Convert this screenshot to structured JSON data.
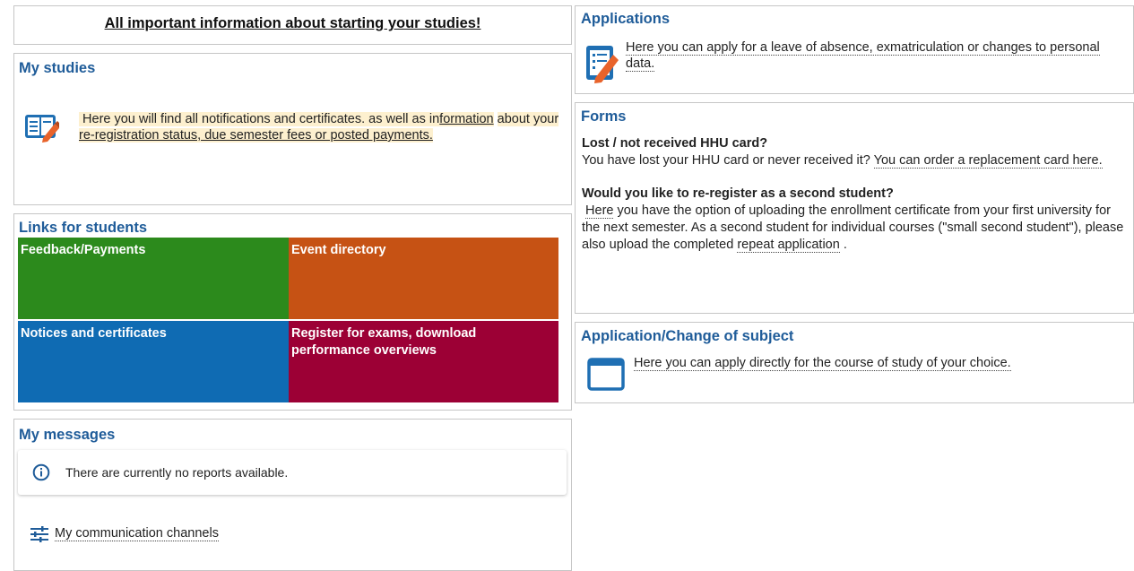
{
  "banner": {
    "link": "All important information about starting your studies!"
  },
  "my_studies": {
    "title": "My studies",
    "text_prefix": "Here you will find all notifications and certificates. as well as in",
    "text_link1": "formation",
    "text_mid": "about your",
    "text_link2": " re-registration status, due semester fees or posted payments."
  },
  "links_for_students": {
    "title": "Links for students",
    "tiles": [
      {
        "label": "Feedback/Payments",
        "color": "#2c8a1c"
      },
      {
        "label": "Event directory",
        "color": "#c65214"
      },
      {
        "label": "Notices and certificates",
        "color": "#0f6bb3"
      },
      {
        "label": "Register for exams, download performance overviews",
        "color": "#9c0035"
      }
    ]
  },
  "my_messages": {
    "title": "My messages",
    "notice": "There are currently no reports available.",
    "channels_link": "My communication channels"
  },
  "applications": {
    "title": "Applications",
    "link": "Here you can apply for a leave of absence, exmatriculation or changes to personal data."
  },
  "forms": {
    "title": "Forms",
    "q1_heading": "Lost / not received HHU card?",
    "q1_text": "You have lost your HHU card or never received it? ",
    "q1_link": "You can order a replacement card here.",
    "q2_heading": "Would you like to re-register as a second student?",
    "q2_link1": "Here",
    "q2_text": " you have the option of uploading the enrollment certificate from your first university for the next semester. As a second student for individual courses (\"small second student\"), please also upload the completed ",
    "q2_link2": "repeat application",
    "q2_end": " ."
  },
  "change_subject": {
    "title": "Application/Change of subject",
    "link": "Here you can apply directly for the course of study of your choice."
  },
  "colors": {
    "accent": "#1f5c99",
    "icon_blue": "#1f6fb3",
    "icon_orange": "#e8632b"
  },
  "icons": [
    "book-pencil-icon",
    "form-pencil-icon",
    "info-icon",
    "sliders-icon",
    "window-icon"
  ]
}
